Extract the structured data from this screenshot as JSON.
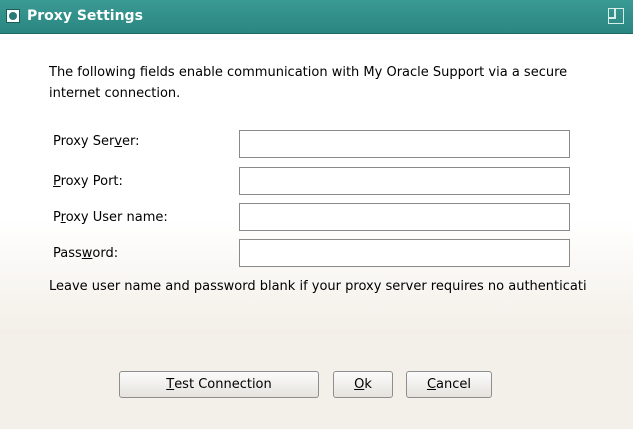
{
  "window": {
    "title": "Proxy Settings",
    "colors": {
      "titlebar": "#2f8e88",
      "title_text": "#ffffff"
    }
  },
  "intro_text": "The following fields enable communication with My Oracle Support via a secure internet connection.",
  "fields": {
    "proxy_server": {
      "label_pre": "Proxy Ser",
      "mnemonic": "v",
      "label_post": "er:",
      "value": ""
    },
    "proxy_port": {
      "label_pre": "",
      "mnemonic": "P",
      "label_post": "roxy Port:",
      "value": ""
    },
    "proxy_user": {
      "label_pre": "P",
      "mnemonic": "r",
      "label_post": "oxy User name:",
      "value": ""
    },
    "password": {
      "label_pre": "Pass",
      "mnemonic": "w",
      "label_post": "ord:",
      "value": ""
    }
  },
  "note": "Leave user name and password blank if your proxy server requires no authenticati",
  "buttons": {
    "test_connection": {
      "pre": "",
      "mnemonic": "T",
      "post": "est Connection"
    },
    "ok": {
      "pre": "",
      "mnemonic": "O",
      "post": "k"
    },
    "cancel": {
      "pre": "",
      "mnemonic": "C",
      "post": "ancel"
    }
  }
}
